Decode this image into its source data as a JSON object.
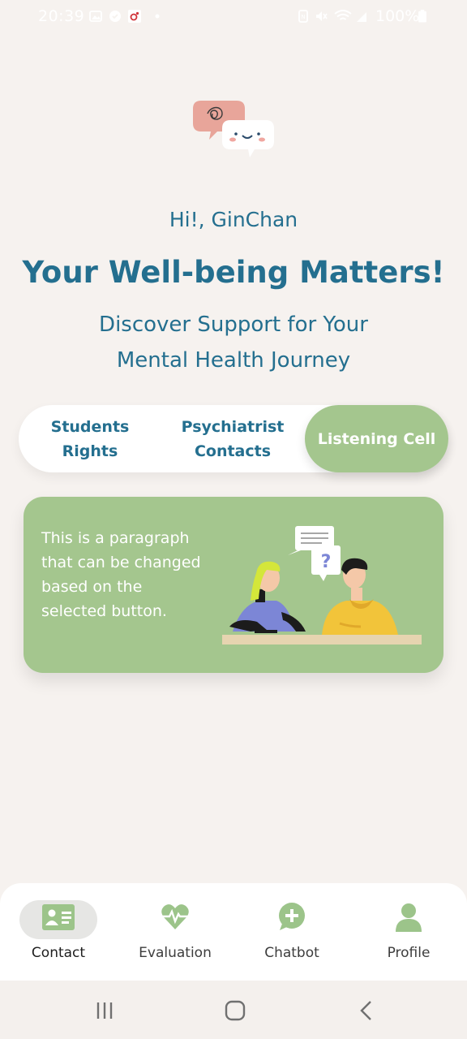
{
  "status_bar": {
    "time": "20:39",
    "battery": "100%",
    "icons": [
      "gallery-icon",
      "shield-icon",
      "app-notification-icon",
      "dot-icon",
      "nfc-icon",
      "mute-icon",
      "wifi-icon",
      "signal-icon",
      "battery-icon"
    ]
  },
  "header": {
    "greeting": "Hi!, GinChan",
    "headline": "Your Well-being Matters!",
    "subtitle": "Discover Support for Your Mental Health Journey"
  },
  "segments": {
    "items": [
      {
        "label": "Students Rights"
      },
      {
        "label": "Psychiatrist Contacts"
      },
      {
        "label": "Listening Cell"
      }
    ],
    "selected": "Listening Cell"
  },
  "card": {
    "text": "This is a paragraph that can be changed based on the selected button."
  },
  "bottom_nav": {
    "items": [
      {
        "label": "Contact",
        "icon": "contact-card-icon"
      },
      {
        "label": "Evaluation",
        "icon": "heart-pulse-icon"
      },
      {
        "label": "Chatbot",
        "icon": "chat-plus-icon"
      },
      {
        "label": "Profile",
        "icon": "person-icon"
      }
    ],
    "active": "Contact"
  },
  "colors": {
    "primary_text": "#246f8f",
    "accent_green": "#a4c68e",
    "background": "#f6f2ef"
  }
}
